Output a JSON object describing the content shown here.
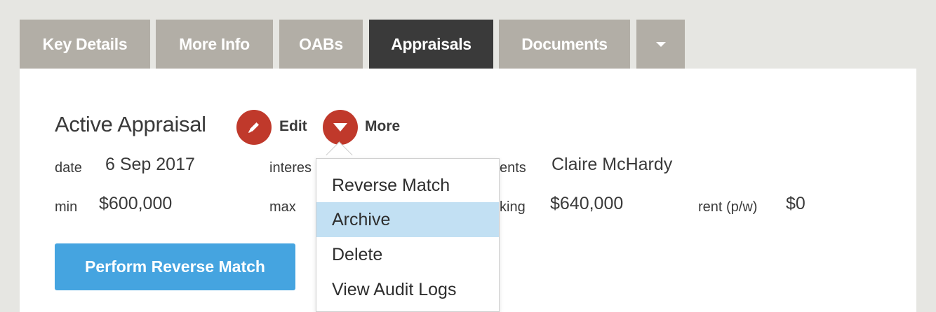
{
  "tabs": [
    {
      "label": "Key Details"
    },
    {
      "label": "More Info"
    },
    {
      "label": "OABs"
    },
    {
      "label": "Appraisals",
      "active": true
    },
    {
      "label": "Documents"
    }
  ],
  "appraisal": {
    "title": "Active Appraisal",
    "edit_label": "Edit",
    "more_label": "More",
    "fields": {
      "date_label": "date",
      "date_value": "6 Sep 2017",
      "interest_label": "interes",
      "agents_label": "ents",
      "agents_value": "Claire McHardy",
      "min_label": "min",
      "min_value": "$600,000",
      "max_label": "max",
      "asking_label": "king",
      "asking_value": "$640,000",
      "rent_label": "rent (p/w)",
      "rent_value": "$0"
    },
    "primary_button": "Perform Reverse Match"
  },
  "more_menu": {
    "items": [
      "Reverse Match",
      "Archive",
      "Delete",
      "View Audit Logs"
    ],
    "highlighted": "Archive"
  },
  "colors": {
    "tab_bg": "#b2aea6",
    "tab_active_bg": "#3a3a3a",
    "accent_red": "#c0392b",
    "primary_blue": "#45a4e0",
    "menu_highlight": "#c2e0f3"
  },
  "icons": {
    "edit": "pencil-icon",
    "more": "caret-down-icon",
    "tab_overflow": "chevron-down-icon"
  }
}
